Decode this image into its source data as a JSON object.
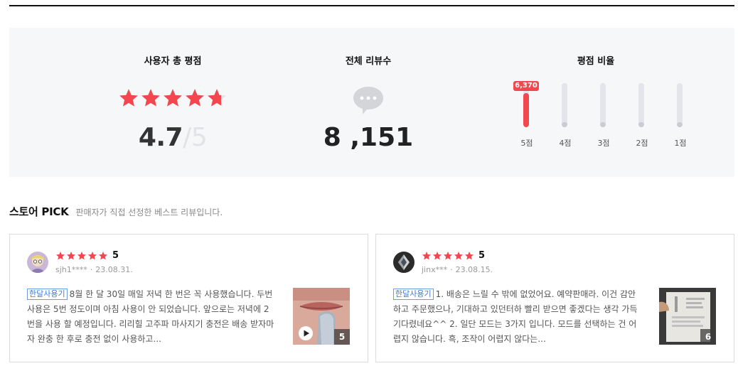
{
  "summary": {
    "rating_title": "사용자 총 평점",
    "rating_value": "4.7",
    "rating_max": "/5",
    "rating_fraction": 0.94,
    "count_title": "전체 리뷰수",
    "review_count": "8 ,151",
    "dist_title": "평점 비율",
    "distribution": [
      {
        "label": "5점",
        "fill": 0.78,
        "badge": "6,370"
      },
      {
        "label": "4점",
        "fill": 0.12,
        "badge": ""
      },
      {
        "label": "3점",
        "fill": 0.12,
        "badge": ""
      },
      {
        "label": "2점",
        "fill": 0.12,
        "badge": ""
      },
      {
        "label": "1점",
        "fill": 0.12,
        "badge": ""
      }
    ]
  },
  "pick": {
    "title": "스토어 PICK",
    "description": "판매자가 직접 선정한 베스트 리뷰입니다."
  },
  "reviews": [
    {
      "score": "5",
      "user": "sjh1****",
      "date": "23.08.31.",
      "tag": "한달사용기",
      "text": "8월 한 달 30일 매일 저녁 한 번은 꼭 사용했습니다. 두번 사용은 5번 정도이며 아침 사용이 안 되었습니다. 앞으로는 저녁에 2번을 사용 할 예정입니다. 리리힐 고주파 마사지기 충전은 배송 받자마자 완충 한 후로 충전 없이 사용하고...",
      "photo_count": "5"
    },
    {
      "score": "5",
      "user": "jinx***",
      "date": "23.08.15.",
      "tag": "한달사용기",
      "text": "1. 배송은 느릴 수 밖에 없었어요. 예약판매라. 이건 감안하고 주문했으나, 기대하고 있던터하 빨리 받으면 좋겠다는 생각 가득 기다렸네요^^ 2. 일단 모드는 3가지 입니다. 모드를 선택하는 건 어렵지 않습니다. 흑, 조작이 어렵지 않다는...",
      "photo_count": "6"
    }
  ],
  "colors": {
    "accent": "#f2474f",
    "star_empty": "#e2e3e6",
    "panel": "#f6f7f9",
    "tag_blue": "#3f7bd6"
  }
}
